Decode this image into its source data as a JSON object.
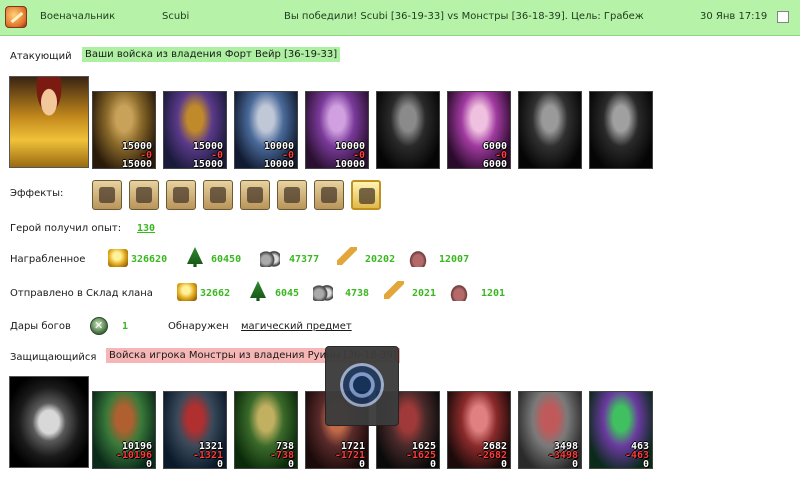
{
  "header": {
    "role": "Военачальник",
    "player": "Scubi",
    "result": "Вы победили! Scubi [36-19-33] vs Монстры [36-18-39]. Цель: Грабеж",
    "date": "30 Янв 17:19"
  },
  "attacker": {
    "label": "Атакующий",
    "tag": "Ваши войска из владения Форт Вейр [36-19-33]",
    "units": [
      {
        "name": "unit-1",
        "start": "15000",
        "loss": "-0",
        "end": "15000",
        "colors": [
          "#2a1a0a",
          "#8a6a2a",
          "#c9a25a"
        ]
      },
      {
        "name": "unit-2",
        "start": "15000",
        "loss": "-0",
        "end": "15000",
        "colors": [
          "#1a1a3a",
          "#5a3a8a",
          "#c08a2a"
        ]
      },
      {
        "name": "unit-3",
        "start": "10000",
        "loss": "-0",
        "end": "10000",
        "colors": [
          "#101a30",
          "#4a6a9a",
          "#c0c8d8"
        ]
      },
      {
        "name": "unit-4",
        "start": "10000",
        "loss": "-0",
        "end": "10000",
        "colors": [
          "#2a1030",
          "#7a3a9a",
          "#d0a0e0"
        ]
      },
      {
        "name": "unit-5",
        "start": "",
        "loss": "",
        "end": "",
        "colors": [
          "#050505",
          "#2a2a2a",
          "#8a8a8a"
        ]
      },
      {
        "name": "unit-6",
        "start": "6000",
        "loss": "-0",
        "end": "6000",
        "colors": [
          "#2a0a2a",
          "#a03aa0",
          "#f0c0e0"
        ]
      },
      {
        "name": "unit-7",
        "start": "",
        "loss": "",
        "end": "",
        "colors": [
          "#050505",
          "#303030",
          "#9a9a9a"
        ]
      },
      {
        "name": "unit-8",
        "start": "",
        "loss": "",
        "end": "",
        "colors": [
          "#050505",
          "#2a2a2a",
          "#a0a0a0"
        ]
      }
    ]
  },
  "effects": {
    "label": "Эффекты:",
    "icons": [
      "helmet-icon",
      "gauntlets-icon",
      "armor-icon",
      "boots-icon",
      "scroll-icon",
      "sword-icon",
      "shield-icon",
      "scroll-bundle-icon"
    ]
  },
  "experience": {
    "label": "Герой получил опыт:",
    "value": "130"
  },
  "loot": {
    "label": "Награбленное",
    "resources": [
      {
        "icon": "gold-icon",
        "value": "326620"
      },
      {
        "icon": "wood-icon",
        "value": "60450"
      },
      {
        "icon": "ore-icon",
        "value": "47377"
      },
      {
        "icon": "grain-icon",
        "value": "20202"
      },
      {
        "icon": "stone-icon",
        "value": "12007"
      }
    ]
  },
  "clan": {
    "label": "Отправлено в Склад клана",
    "resources": [
      {
        "icon": "gold-icon",
        "value": "32662"
      },
      {
        "icon": "wood-icon",
        "value": "6045"
      },
      {
        "icon": "ore-icon",
        "value": "4738"
      },
      {
        "icon": "grain-icon",
        "value": "2021"
      },
      {
        "icon": "stone-icon",
        "value": "1201"
      }
    ]
  },
  "gifts": {
    "label": "Дары богов",
    "value": "1",
    "found_label": "Обнаружен",
    "found_link": "магический предмет"
  },
  "defender": {
    "label": "Защищающийся",
    "tag": "Войска игрока Монстры из владения Руины [36-18-39]",
    "units": [
      {
        "name": "unit-1",
        "start": "10196",
        "loss": "-10196",
        "end": "0",
        "colors": [
          "#0a2a1a",
          "#3a7a3a",
          "#b06030"
        ]
      },
      {
        "name": "unit-2",
        "start": "1321",
        "loss": "-1321",
        "end": "0",
        "colors": [
          "#0a1a2a",
          "#3a4a5a",
          "#b03030"
        ]
      },
      {
        "name": "unit-3",
        "start": "738",
        "loss": "-738",
        "end": "0",
        "colors": [
          "#0a2a0a",
          "#3a6a2a",
          "#c0b060"
        ]
      },
      {
        "name": "unit-4",
        "start": "1721",
        "loss": "-1721",
        "end": "0",
        "colors": [
          "#1a0a0a",
          "#5a2a2a",
          "#c06a4a"
        ]
      },
      {
        "name": "unit-5",
        "start": "1625",
        "loss": "-1625",
        "end": "0",
        "colors": [
          "#0a0a0a",
          "#4a2a2a",
          "#a03a3a"
        ]
      },
      {
        "name": "unit-6",
        "start": "2682",
        "loss": "-2682",
        "end": "0",
        "colors": [
          "#1a0a0a",
          "#8a2a2a",
          "#e08080"
        ]
      },
      {
        "name": "unit-7",
        "start": "3498",
        "loss": "-3498",
        "end": "0",
        "colors": [
          "#2a2a2a",
          "#7a7a7a",
          "#c05a5a"
        ]
      },
      {
        "name": "unit-8",
        "start": "463",
        "loss": "-463",
        "end": "0",
        "colors": [
          "#0a2a1a",
          "#6a3aa0",
          "#40c060"
        ]
      }
    ]
  },
  "tooltip": {
    "icon": "pentagon-amulet-icon"
  }
}
